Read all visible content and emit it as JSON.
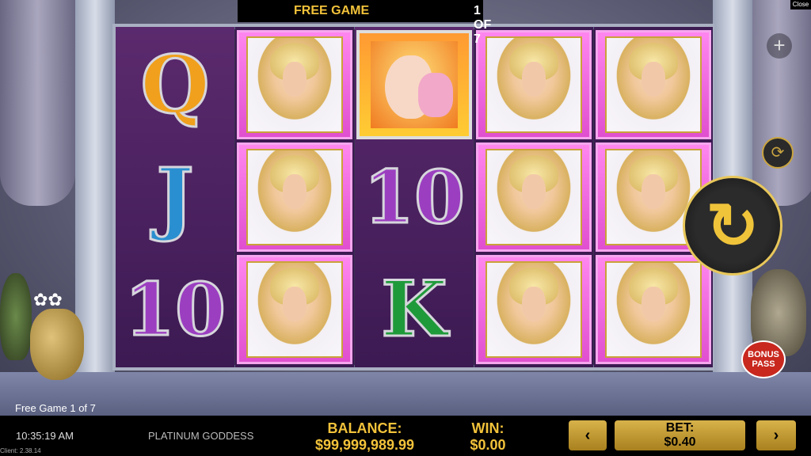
{
  "header": {
    "mode_label": "FREE GAME",
    "counter": "1 OF 7",
    "close_label": "Close"
  },
  "controls": {
    "plus_symbol": "+",
    "turbo_symbol": "⟳",
    "spin_symbol": "↻",
    "bonus_pass_label": "BONUS PASS"
  },
  "reels": {
    "col1": [
      "Q",
      "J",
      "10"
    ],
    "col2": [
      "goddess",
      "goddess",
      "goddess"
    ],
    "col3": [
      "pegasus",
      "10",
      "K"
    ],
    "col4": [
      "goddess",
      "goddess",
      "goddess"
    ],
    "col5": [
      "goddess",
      "goddess",
      "goddess"
    ]
  },
  "status": {
    "free_game_text": "Free Game 1 of 7"
  },
  "footer": {
    "time": "10:35:19 AM",
    "client_version": "Client: 2.38.14",
    "game_title": "PLATINUM GODDESS",
    "balance_label": "BALANCE:",
    "balance_value": "$99,999,989.99",
    "win_label": "WIN:",
    "win_value": "$0.00",
    "bet_label": "BET:",
    "bet_value": "$0.40",
    "prev_symbol": "‹",
    "next_symbol": "›"
  },
  "colors": {
    "accent_gold": "#f2c23a",
    "goddess_pink": "#ff86ef"
  }
}
